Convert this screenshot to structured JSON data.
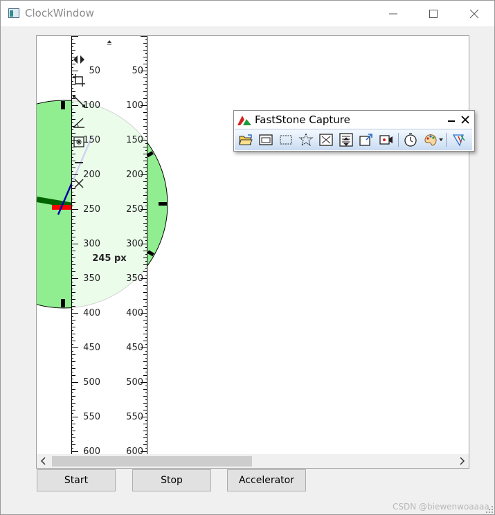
{
  "window": {
    "title": "ClockWindow",
    "icon": "window-app-icon"
  },
  "window_controls": [
    "minimize-icon",
    "maximize-icon",
    "close-icon"
  ],
  "clock": {
    "face_color": "#90ee90",
    "hour_hand_color": "#006400",
    "minute_hand_color": "#0000aa",
    "second_hand_color": "#ff0000"
  },
  "ruler": {
    "ticks_left": [
      "50",
      "100",
      "150",
      "200",
      "250",
      "300",
      "350",
      "400",
      "450",
      "500",
      "550",
      "600"
    ],
    "ticks_right": [
      "50",
      "100",
      "150",
      "200",
      "250",
      "300",
      "350",
      "400",
      "450",
      "500",
      "550",
      "600"
    ],
    "readout": "245 px",
    "tools": [
      "flip-arrows-icon",
      "crop-icon",
      "line-measure-icon",
      "angle-icon",
      "center-icon",
      "minimize-line-icon",
      "close-x-icon"
    ]
  },
  "faststone": {
    "title": "FastStone Capture",
    "tools": [
      "open-folder-icon",
      "capture-window-icon",
      "capture-rectangle-icon",
      "capture-freehand-icon",
      "capture-fullscreen-icon",
      "capture-scrolling-icon",
      "output-icon",
      "video-record-icon",
      "timer-icon",
      "color-picker-icon",
      "settings-icon"
    ]
  },
  "buttons": {
    "start": "Start",
    "stop": "Stop",
    "accelerator": "Accelerator"
  },
  "watermark": "CSDN @biewenwoaaaa"
}
